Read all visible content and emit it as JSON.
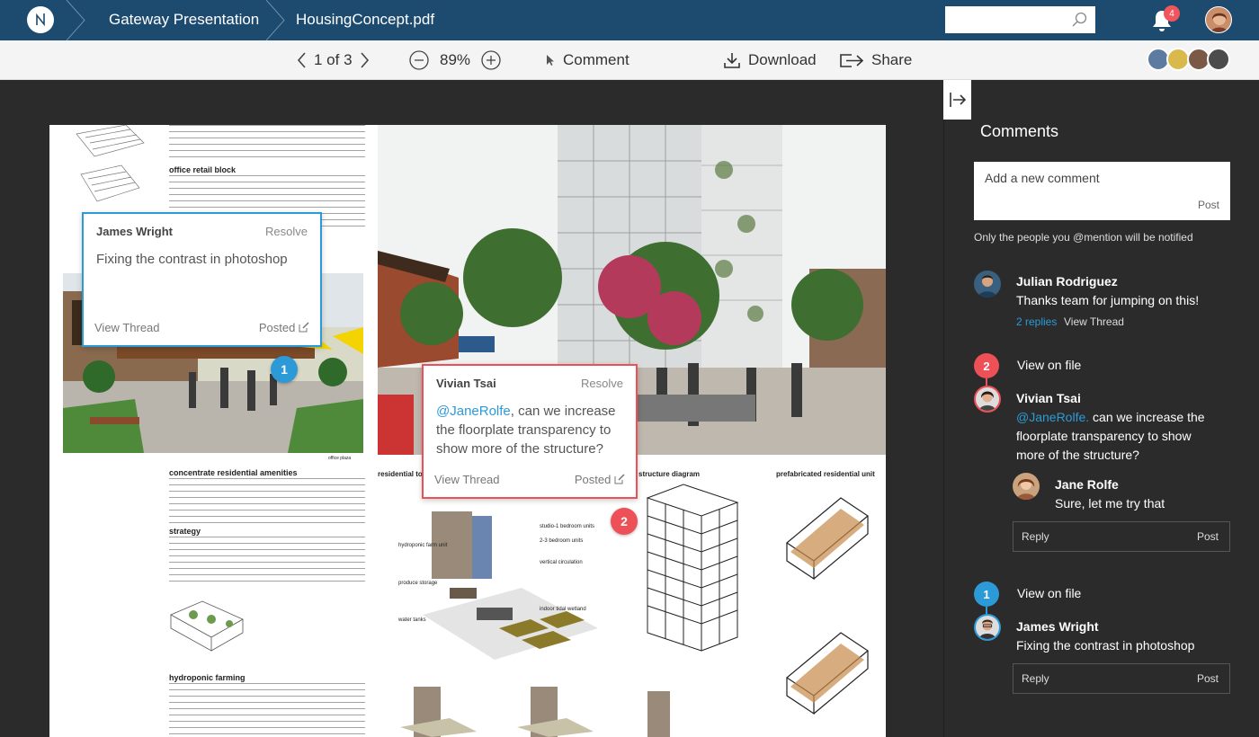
{
  "nav": {
    "breadcrumb_project": "Gateway Presentation",
    "breadcrumb_file": "HousingConcept.pdf",
    "search_placeholder": "",
    "notification_count": "4"
  },
  "toolbar": {
    "page_indicator": "1 of 3",
    "zoom": "89%",
    "comment_label": "Comment",
    "download_label": "Download",
    "share_label": "Share"
  },
  "document": {
    "section_office_retail": "office retail block",
    "section_residential": "concentrate residential amenities",
    "section_strategy": "strategy",
    "section_hydroponic": "hydroponic farming",
    "diagram_residential_tower": "residential tow",
    "diagram_structure": "structure diagram",
    "diagram_prefab": "prefabricated residential unit",
    "caption_office_plaza": "office plaza",
    "labels": [
      "studio-1 bedroom units",
      "2-3 bedroom units",
      "vertical circulation",
      "hydroponic farm unit",
      "produce storage",
      "indoor tidal wetland",
      "water tanks"
    ]
  },
  "pins": [
    {
      "number": "1",
      "color": "#2d9ad8"
    },
    {
      "number": "2",
      "color": "#ee5058"
    }
  ],
  "popups": {
    "james": {
      "name": "James Wright",
      "resolve": "Resolve",
      "body": "Fixing the contrast in photoshop",
      "view_thread": "View Thread",
      "posted": "Posted"
    },
    "vivian": {
      "name": "Vivian Tsai",
      "resolve": "Resolve",
      "mention": "@JaneRolfe",
      "body": ", can we increase the floorplate transparency to show more of the structure?",
      "view_thread": "View Thread",
      "posted": "Posted"
    }
  },
  "panel": {
    "title": "Comments",
    "new_comment_placeholder": "Add a new comment",
    "post_label": "Post",
    "notice": "Only the people you @mention will be notified",
    "threads": [
      {
        "name": "Julian Rodriguez",
        "body": "Thanks team for jumping on this!",
        "replies": "2 replies",
        "view_thread": "View Thread"
      },
      {
        "pin": "2",
        "view_on_file": "View on file",
        "name": "Vivian Tsai",
        "mention": "@JaneRolfe.",
        "body": " can we increase the floorplate transparency to show more of the structure?",
        "reply_name": "Jane Rolfe",
        "reply_body": "Sure, let me try that",
        "reply_placeholder": "Reply",
        "post": "Post"
      },
      {
        "pin": "1",
        "view_on_file": "View on file",
        "name": "James Wright",
        "body": "Fixing the contrast in photoshop",
        "reply_placeholder": "Reply",
        "post": "Post"
      }
    ]
  },
  "colors": {
    "nav_bg": "#1d4a6f",
    "accent_blue": "#2d9ad8",
    "accent_red": "#ee5058",
    "panel_bg": "#2b2b2b"
  }
}
